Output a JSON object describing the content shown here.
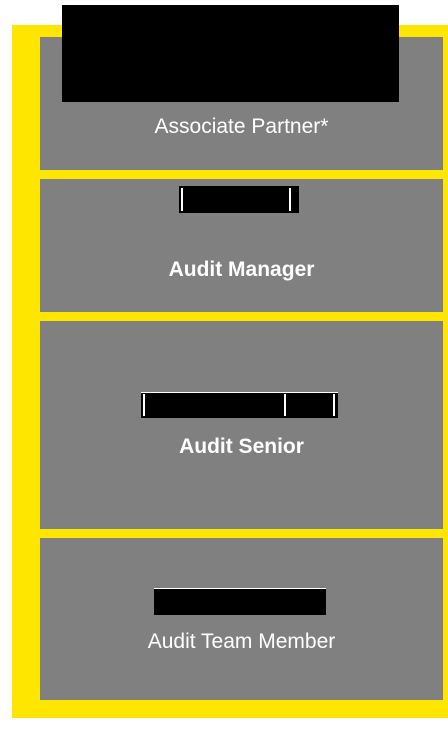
{
  "colors": {
    "frame": "#ffe600",
    "panel": "#808080",
    "text": "#ffffff",
    "redaction": "#000000"
  },
  "levels": [
    {
      "title": "Associate Partner*"
    },
    {
      "title": "Audit Manager"
    },
    {
      "title": "Audit Senior"
    },
    {
      "title": "Audit Team Member"
    }
  ]
}
